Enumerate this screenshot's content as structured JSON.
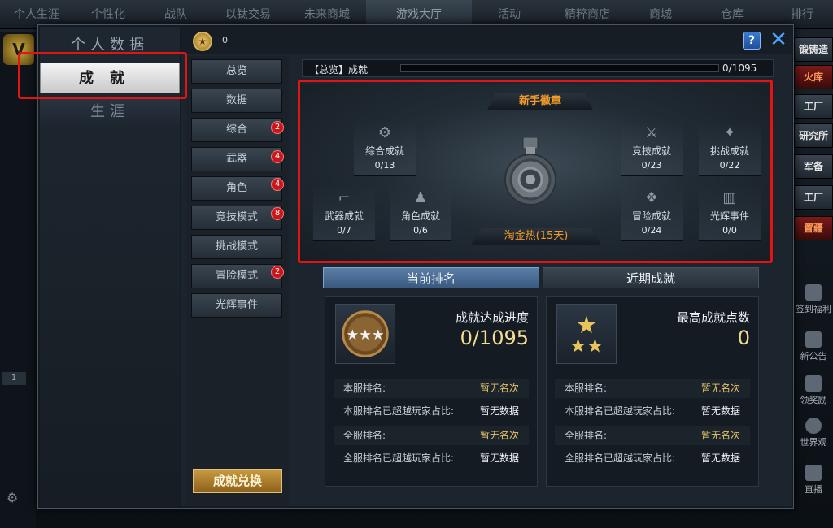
{
  "top_nav": [
    "个人生涯",
    "个性化",
    "战队",
    "以钛交易",
    "未来商城",
    "游戏大厅",
    "活动",
    "精粹商店",
    "商城",
    "仓库",
    "排行"
  ],
  "top_nav_active": "游戏大厅",
  "right_strip": [
    "锻铸造",
    "火库",
    "工厂",
    "研究所",
    "军备",
    "工厂",
    "置疆",
    "签到福利",
    "新公告",
    "领奖励",
    "世界观",
    "直播"
  ],
  "left": {
    "tab_number": "1"
  },
  "sidebar": {
    "items": [
      "个人数据",
      "成就",
      "生涯"
    ],
    "active": "成就"
  },
  "header": {
    "coin_value": "0",
    "help": "?",
    "close": "✕"
  },
  "categories": [
    {
      "label": "总览",
      "badge": ""
    },
    {
      "label": "数据",
      "badge": ""
    },
    {
      "label": "综合",
      "badge": "2"
    },
    {
      "label": "武器",
      "badge": "4"
    },
    {
      "label": "角色",
      "badge": "4"
    },
    {
      "label": "竞技模式",
      "badge": "8"
    },
    {
      "label": "挑战模式",
      "badge": ""
    },
    {
      "label": "冒险模式",
      "badge": "2"
    },
    {
      "label": "光辉事件",
      "badge": ""
    }
  ],
  "exchange_button": "成就兑换",
  "overview": {
    "label": "【总览】成就",
    "progress": "0/1095",
    "progress_value": 0
  },
  "medal": {
    "badge_title": "新手徽章",
    "medal_name": "淘金热(15天)"
  },
  "achievements": [
    {
      "name": "综合成就",
      "progress": "0/13",
      "icon": "gear-icon"
    },
    {
      "name": "武器成就",
      "progress": "0/7",
      "icon": "rifle-icon"
    },
    {
      "name": "角色成就",
      "progress": "0/6",
      "icon": "person-icon"
    },
    {
      "name": "竞技成就",
      "progress": "0/23",
      "icon": "crossed-swords-icon"
    },
    {
      "name": "挑战成就",
      "progress": "0/22",
      "icon": "wings-icon"
    },
    {
      "name": "冒险成就",
      "progress": "0/24",
      "icon": "chevron-emblem-icon"
    },
    {
      "name": "光辉事件",
      "progress": "0/0",
      "icon": "book-icon"
    }
  ],
  "ranking_tabs": [
    "当前排名",
    "近期成就"
  ],
  "panels": [
    {
      "title": "成就达成进度",
      "value": "0/1095",
      "rows": [
        {
          "k": "本服排名:",
          "v": "暂无名次"
        },
        {
          "k": "本服排名已超越玩家占比:",
          "v": "暂无数据"
        },
        {
          "k": "全服排名:",
          "v": "暂无名次"
        },
        {
          "k": "全服排名已超越玩家占比:",
          "v": "暂无数据"
        }
      ]
    },
    {
      "title": "最高成就点数",
      "value": "0",
      "rows": [
        {
          "k": "本服排名:",
          "v": "暂无名次"
        },
        {
          "k": "本服排名已超越玩家占比:",
          "v": "暂无数据"
        },
        {
          "k": "全服排名:",
          "v": "暂无名次"
        },
        {
          "k": "全服排名已超越玩家占比:",
          "v": "暂无数据"
        }
      ]
    }
  ]
}
